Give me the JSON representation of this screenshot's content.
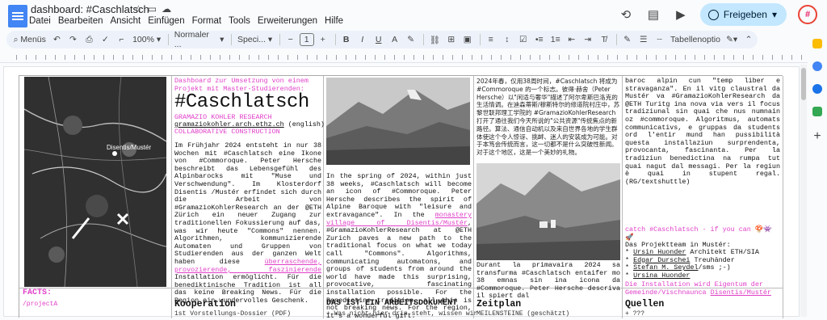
{
  "window": {
    "title": "dashboard: #Caschlatsch",
    "menu": [
      "Datei",
      "Bearbeiten",
      "Ansicht",
      "Einfügen",
      "Format",
      "Tools",
      "Erweiterungen",
      "Hilfe"
    ],
    "share_label": "Freigeben",
    "avatar_text": "#"
  },
  "toolbar": {
    "search_label": "Menüs",
    "zoom": "100%",
    "style": "Normaler ...",
    "font": "Speci...",
    "font_size": "1",
    "table_options": "Tabellenoptio"
  },
  "colors": {
    "accent": "#e040c8",
    "share_bg": "#c2e7ff"
  },
  "doc": {
    "col1": {
      "facts_title": "FACTS:",
      "facts_line": "/projectA"
    },
    "col2": {
      "intro": "Dashboard zur Umsetzung von einem Projekt mit Master-Studierenden:",
      "title": "#Caschlatsch",
      "org1": "GRAMAZIO KOHLER RESEARCH",
      "url": "gramaziokohler.arch.ethz.ch",
      "url_suffix": " (english)",
      "org2": "COLLABORATIVE CONSTRUCTION",
      "body_a": "Im Frühjahr 2024 entsteht in nur 38 Wochen mit #Caschlatsch eine Ikone von #Commoroque. Peter Hersche beschreibt das Lebensgefühl des Alpinbarocks mit \"Muse und Verschwendung\". Im Klosterdorf Disentis /Mustér erfindet sich durch die Arbeit von #GramazioKohlerResearch an der @ETH Zürich ein neuer Zugang zur traditionellen Fokussierung auf das, was wir heute \"Commons\" nennen. Algorithmen, kommunizierende Automaten und Gruppen von Studierenden aus der ganzen Welt haben diese",
      "body_pink": "überraschende, provozierende, faszinierende",
      "body_b": "Installation ermöglicht. Für die benediktinische Tradition ist all das keine Breaking News. Für die Region ein wundervolles Geschenk.",
      "section": "Kooperation",
      "section_sub": "1st Vorstellungs-Dossier (PDF)"
    },
    "col3": {
      "body_a": "In the spring of 2024, within just 38 weeks, #Caschlatsch will become an icon of #Commoroque. Peter Hersche describes the spirit of Alpine Baroque with \"leisure and extravagance\". In the",
      "body_pink": "monastery village of Disentis/Mustér",
      "body_b": ", #GramazioKohlerResearch at @ETH Zurich paves a new path to the traditional focus on what we today call \"Commons\". Algorithms, communicating automatons, and groups of students from around the world have made this surprising, provocative, fascinating installation possible. For the Benedictine tradition, all this is not breaking news. For the region, it's a wonderful gift.",
      "section": "DAS IST EIN ARBEITSDOKUMENT",
      "section_sub": "+ Was nicht hier drin steht, wissen wir"
    },
    "col4": {
      "body_zh": "2024年春，仅用38周时间，#Caschlatsch 将成为 #Commoroque 的一个标志。彼得·赫舍（Peter Hersche）以\"闲适与奢华\"描述了阿尔卑斯巴洛克的生活情调。在迪森蒂斯/穆斯特尔的修道院村庄中，苏黎世联邦理工学院的 #GramazioKohlerResearch 打开了通往我们今天所说的\"公共资源\"传统焦点的新路径。算法、通信自动机以及来自世界各地的学生群体使这个令人惊讶、挑衅、迷人的安装成为可能。对于本笃会传统而言，这一切都不是什么突破性新闻。对于这个地区，这是一个美妙的礼物。",
      "body_rm": "Durant la primavaira 2024 sa transfurma #Caschlatsch entaifer mo 38 emnas sin ina icona da #Commoroque. Peter Hersche descriva il spiert dal",
      "section": "Zeitplan",
      "section_sub": "MEILENSTEINE (geschätzt)"
    },
    "col5": {
      "body_rm": "baroc alpin cun \"temp liber e stravaganza\". En il vitg claustral da Mustér va #GramazioKohlerResearch da @ETH Turitg ina nova via vers il focus tradiziunal sin quai che nus numnain oz #commoroque. Algoritmus, automats communicativs, e gruppas da students ord l'entir mund han pussibilità questa installaziun surprendenta, provocanta, fascinanta. Per la tradiziun benedictina na rumpa tut quai nagut dal messagi. Per la regiun è quai in stupent regal. (RG/textshuttle)",
      "catch": "catch #Caschlatsch - if you can 🍄👾🚀",
      "team_title": "Das Projektteam in Mustér:",
      "team": [
        {
          "name": "Ursin Huonder",
          "role": " Architekt ETH/SIA"
        },
        {
          "name": "Edgar Durschei",
          "role": " Treuhänder"
        },
        {
          "name": "Stefan M. Seydel",
          "role": "/sms ;-)"
        },
        {
          "name": "Ursina Huonder",
          "role": ""
        }
      ],
      "owner": "Die Installation wird Eigentum der Gemeinde/Vischnaunca",
      "owner_link": "Disentis/Mustér",
      "section": "Quellen",
      "section_sub": "+ ???"
    },
    "map_label": "Disentis/Mustér"
  }
}
